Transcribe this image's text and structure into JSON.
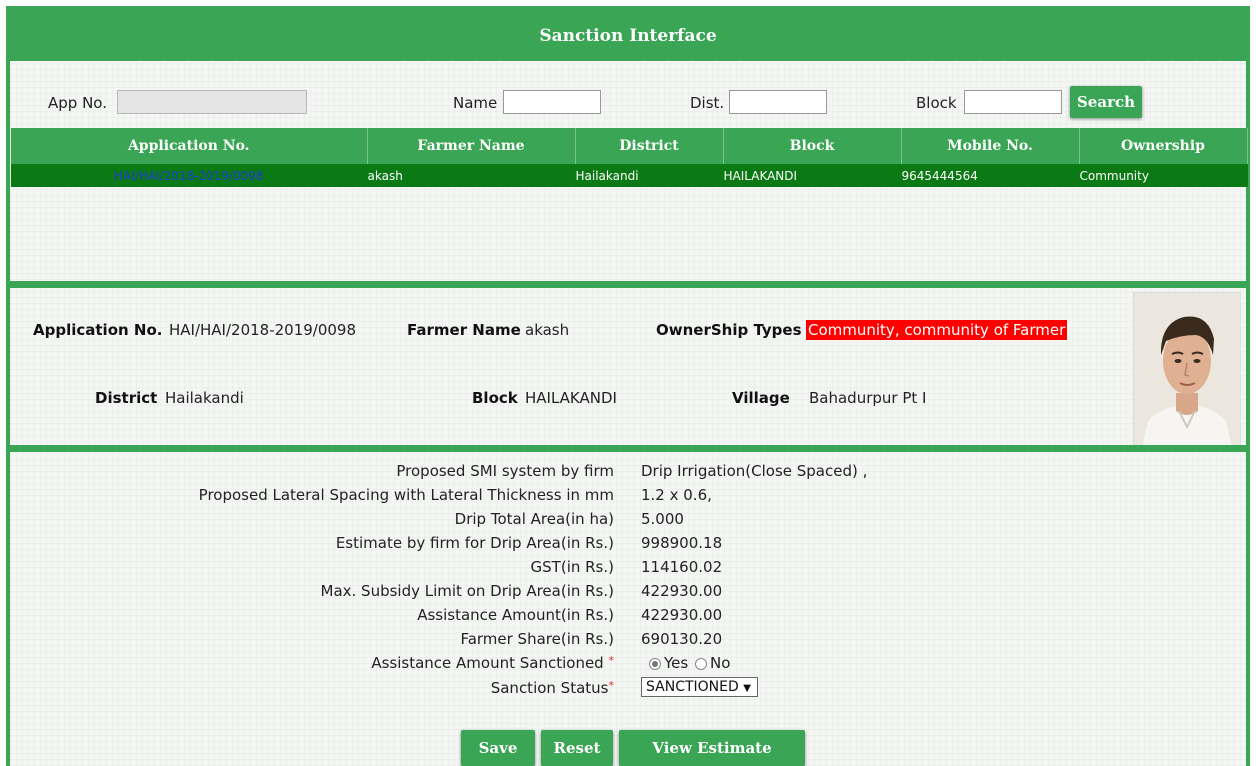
{
  "header": {
    "title": "Sanction Interface"
  },
  "search": {
    "app_no_label": "App No.",
    "app_no_value": "",
    "name_label": "Name",
    "name_value": "",
    "dist_label": "Dist.",
    "dist_value": "",
    "block_label": "Block",
    "block_value": "",
    "search_button": "Search"
  },
  "table": {
    "columns": [
      "Application No.",
      "Farmer Name",
      "District",
      "Block",
      "Mobile No.",
      "Ownership"
    ],
    "rows": [
      [
        "HAI/HAI/2018-2019/0098",
        "akash",
        "Hailakandi",
        "HAILAKANDI",
        "9645444564",
        "Community"
      ]
    ]
  },
  "info": {
    "application_no_label": "Application No.",
    "application_no_value": "HAI/HAI/2018-2019/0098",
    "farmer_name_label": "Farmer Name",
    "farmer_name_value": "akash",
    "ownership_label": "OwnerShip Types",
    "ownership_value": "Community, community of Farmer",
    "district_label": "District",
    "district_value": "Hailakandi",
    "block_label": "Block",
    "block_value": "HAILAKANDI",
    "village_label": "Village",
    "village_value": "Bahadurpur Pt I"
  },
  "details": [
    {
      "label": "Proposed SMI system by firm",
      "value": "Drip Irrigation(Close Spaced) ,"
    },
    {
      "label": "Proposed Lateral Spacing with Lateral Thickness in mm",
      "value": "1.2 x 0.6,"
    },
    {
      "label": "Drip Total Area(in ha)",
      "value": "5.000"
    },
    {
      "label": "Estimate by firm for Drip Area(in Rs.)",
      "value": "998900.18"
    },
    {
      "label": "GST(in Rs.)",
      "value": "114160.02"
    },
    {
      "label": "Max. Subsidy Limit on Drip Area(in Rs.)",
      "value": "422930.00"
    },
    {
      "label": "Assistance Amount(in Rs.)",
      "value": "422930.00"
    },
    {
      "label": "Farmer Share(in Rs.)",
      "value": "690130.20"
    }
  ],
  "sanctioned": {
    "label": "Assistance Amount Sanctioned",
    "required_mark": "*",
    "yes_label": "Yes",
    "no_label": "No",
    "selected": "Yes"
  },
  "status": {
    "label": "Sanction Status",
    "required_mark": "*",
    "selected": "SANCTIONED",
    "arrow": "▼"
  },
  "buttons": {
    "save": "Save",
    "reset": "Reset",
    "view_estimate": "View Estimate"
  },
  "colors": {
    "green": "#3aa655",
    "row_green": "#0b7a14",
    "highlight_red": "#ff0000"
  }
}
